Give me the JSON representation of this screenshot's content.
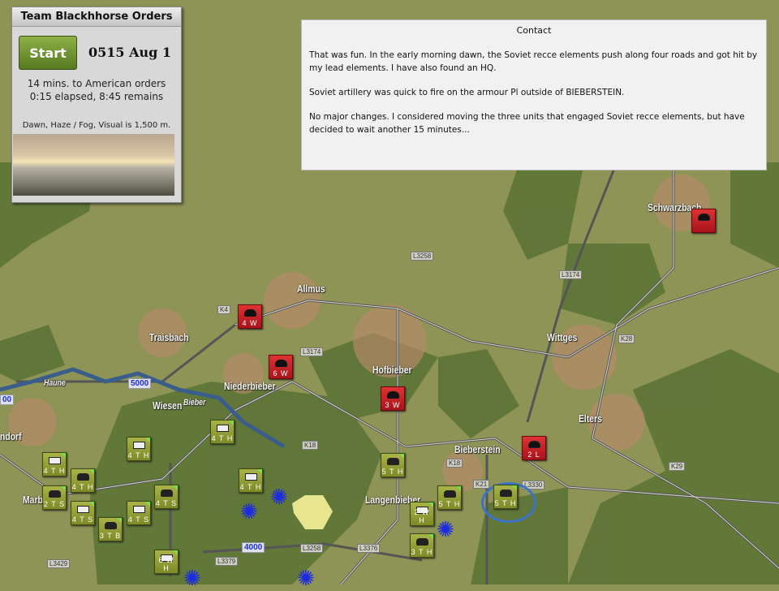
{
  "orders_panel": {
    "title": "Team Blackhhorse Orders",
    "start_label": "Start",
    "clock": "0515 Aug 1",
    "time_to_orders": "14 mins. to American orders",
    "elapsed": "0:15 elapsed, 8:45 remains",
    "weather": "Dawn, Haze / Fog, Visual is 1,500 m."
  },
  "contact_panel": {
    "title": "Contact",
    "paragraphs": [
      "That was fun.  In the early morning dawn, the Soviet recce elements push along four roads and got hit by my lead elements.  I have also found an HQ.",
      "Soviet artillery was quick to fire on the armour Pl outside of BIEBERSTEIN.",
      "No major changes.  I considered moving the three units that engaged Soviet recce elements, but have decided to wait another 15 minutes..."
    ]
  },
  "map": {
    "towns": [
      "Schwarzbach",
      "Allmus",
      "Traisbach",
      "Wittges",
      "Hofbieber",
      "Niederbieber",
      "Elters",
      "Bieberstein",
      "Langenbieber",
      "Haune",
      "Bieber",
      "ndorf",
      "Marbach",
      "Wiesen"
    ],
    "roads": [
      "L3258",
      "K4",
      "L3174",
      "L3174",
      "K28",
      "K18",
      "K18",
      "K29",
      "K21",
      "L3330",
      "L3429",
      "L3379",
      "L3258",
      "L3376"
    ],
    "objectives": [
      "5000",
      "4000",
      "00"
    ],
    "american_units": [
      "4 T H",
      "4 T H",
      "4 T H",
      "4 T H",
      "2 T S",
      "4 T H",
      "4 T S",
      "4 T S",
      "4 T S",
      "3 T B",
      "6 W H",
      "5 T H",
      "5 T H",
      "2 W H",
      "3 T H",
      "5 T H"
    ],
    "soviet_units": [
      "4 W",
      "6 W",
      "3 W",
      "2 L",
      ""
    ],
    "colors": {
      "american": "#8d9a30",
      "soviet": "#c01a22",
      "objective": "#1d2fd0"
    }
  }
}
